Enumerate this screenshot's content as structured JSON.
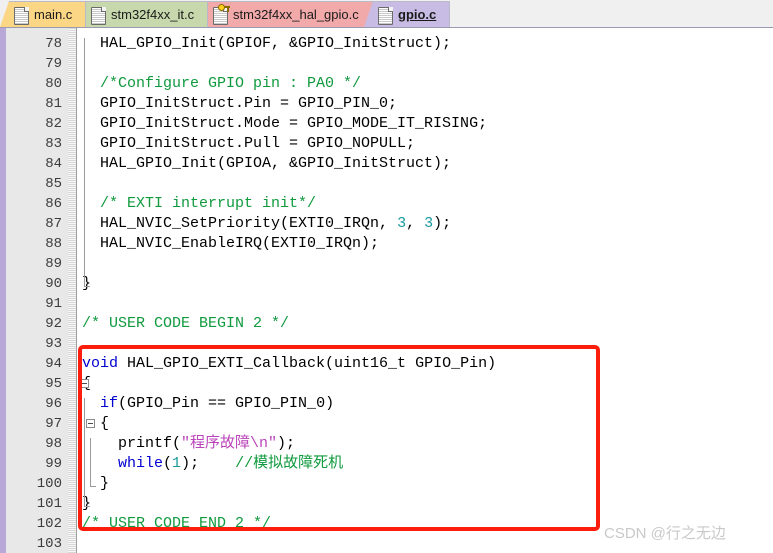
{
  "window": {
    "app_kind": "code-editor",
    "accent_red": "#fc1d0c",
    "left_rail_color": "#b7a8d8"
  },
  "tabs": [
    {
      "label": "main.c",
      "color": "#fbd684",
      "icon": "document-icon",
      "readonly": false,
      "active": false
    },
    {
      "label": "stm32f4xx_it.c",
      "color": "#c7d8ac",
      "icon": "document-icon",
      "readonly": false,
      "active": false
    },
    {
      "label": "stm32f4xx_hal_gpio.c",
      "color": "#f2a9a9",
      "icon": "document-locked-icon",
      "readonly": true,
      "active": false
    },
    {
      "label": "gpio.c",
      "color": "#c8bce4",
      "icon": "document-icon",
      "readonly": false,
      "active": true
    }
  ],
  "editor": {
    "first_line": 78,
    "lines": [
      {
        "n": 78,
        "tokens": [
          {
            "t": "  HAL_GPIO_Init(GPIOF, &GPIO_InitStruct);",
            "c": "plain"
          }
        ]
      },
      {
        "n": 79,
        "tokens": [
          {
            "t": "",
            "c": "plain"
          }
        ]
      },
      {
        "n": 80,
        "tokens": [
          {
            "t": "  ",
            "c": "plain"
          },
          {
            "t": "/*Configure GPIO pin : PA0 */",
            "c": "cmt"
          }
        ]
      },
      {
        "n": 81,
        "tokens": [
          {
            "t": "  GPIO_InitStruct.Pin = GPIO_PIN_0;",
            "c": "plain"
          }
        ]
      },
      {
        "n": 82,
        "tokens": [
          {
            "t": "  GPIO_InitStruct.Mode = GPIO_MODE_IT_RISING;",
            "c": "plain"
          }
        ]
      },
      {
        "n": 83,
        "tokens": [
          {
            "t": "  GPIO_InitStruct.Pull = GPIO_NOPULL;",
            "c": "plain"
          }
        ]
      },
      {
        "n": 84,
        "tokens": [
          {
            "t": "  HAL_GPIO_Init(GPIOA, &GPIO_InitStruct);",
            "c": "plain"
          }
        ]
      },
      {
        "n": 85,
        "tokens": [
          {
            "t": "",
            "c": "plain"
          }
        ]
      },
      {
        "n": 86,
        "tokens": [
          {
            "t": "  ",
            "c": "plain"
          },
          {
            "t": "/* EXTI interrupt init*/",
            "c": "cmt"
          }
        ]
      },
      {
        "n": 87,
        "tokens": [
          {
            "t": "  HAL_NVIC_SetPriority(EXTI0_IRQn, ",
            "c": "plain"
          },
          {
            "t": "3",
            "c": "num"
          },
          {
            "t": ", ",
            "c": "plain"
          },
          {
            "t": "3",
            "c": "num"
          },
          {
            "t": ");",
            "c": "plain"
          }
        ]
      },
      {
        "n": 88,
        "tokens": [
          {
            "t": "  HAL_NVIC_EnableIRQ(EXTI0_IRQn);",
            "c": "plain"
          }
        ]
      },
      {
        "n": 89,
        "tokens": [
          {
            "t": "",
            "c": "plain"
          }
        ]
      },
      {
        "n": 90,
        "tokens": [
          {
            "t": "}",
            "c": "plain"
          }
        ]
      },
      {
        "n": 91,
        "tokens": [
          {
            "t": "",
            "c": "plain"
          }
        ]
      },
      {
        "n": 92,
        "tokens": [
          {
            "t": "/* USER CODE BEGIN 2 */",
            "c": "cmt"
          }
        ]
      },
      {
        "n": 93,
        "tokens": [
          {
            "t": "",
            "c": "plain"
          }
        ]
      },
      {
        "n": 94,
        "tokens": [
          {
            "t": "void",
            "c": "kw"
          },
          {
            "t": " HAL_GPIO_EXTI_Callback(uint16_t GPIO_Pin)",
            "c": "plain"
          }
        ]
      },
      {
        "n": 95,
        "tokens": [
          {
            "t": "{",
            "c": "plain"
          }
        ]
      },
      {
        "n": 96,
        "tokens": [
          {
            "t": "  ",
            "c": "plain"
          },
          {
            "t": "if",
            "c": "kw"
          },
          {
            "t": "(GPIO_Pin == GPIO_PIN_0)",
            "c": "plain"
          }
        ]
      },
      {
        "n": 97,
        "tokens": [
          {
            "t": "  {",
            "c": "plain"
          }
        ]
      },
      {
        "n": 98,
        "tokens": [
          {
            "t": "    printf(",
            "c": "plain"
          },
          {
            "t": "\"程序故障\\n\"",
            "c": "str"
          },
          {
            "t": ");",
            "c": "plain"
          }
        ]
      },
      {
        "n": 99,
        "tokens": [
          {
            "t": "    ",
            "c": "plain"
          },
          {
            "t": "while",
            "c": "kw"
          },
          {
            "t": "(",
            "c": "plain"
          },
          {
            "t": "1",
            "c": "num"
          },
          {
            "t": ");    ",
            "c": "plain"
          },
          {
            "t": "//模拟故障死机",
            "c": "cmt"
          }
        ]
      },
      {
        "n": 100,
        "tokens": [
          {
            "t": "  }",
            "c": "plain"
          }
        ]
      },
      {
        "n": 101,
        "tokens": [
          {
            "t": "}",
            "c": "plain"
          }
        ]
      },
      {
        "n": 102,
        "tokens": [
          {
            "t": "/* USER CODE END 2 */",
            "c": "cmt"
          }
        ]
      },
      {
        "n": 103,
        "tokens": [
          {
            "t": "",
            "c": "plain"
          }
        ]
      }
    ]
  },
  "annotation": {
    "shape": "rectangle",
    "color": "#fc1d0c",
    "covers_lines": "94-102"
  },
  "watermark": {
    "text": "CSDN @行之无边"
  }
}
